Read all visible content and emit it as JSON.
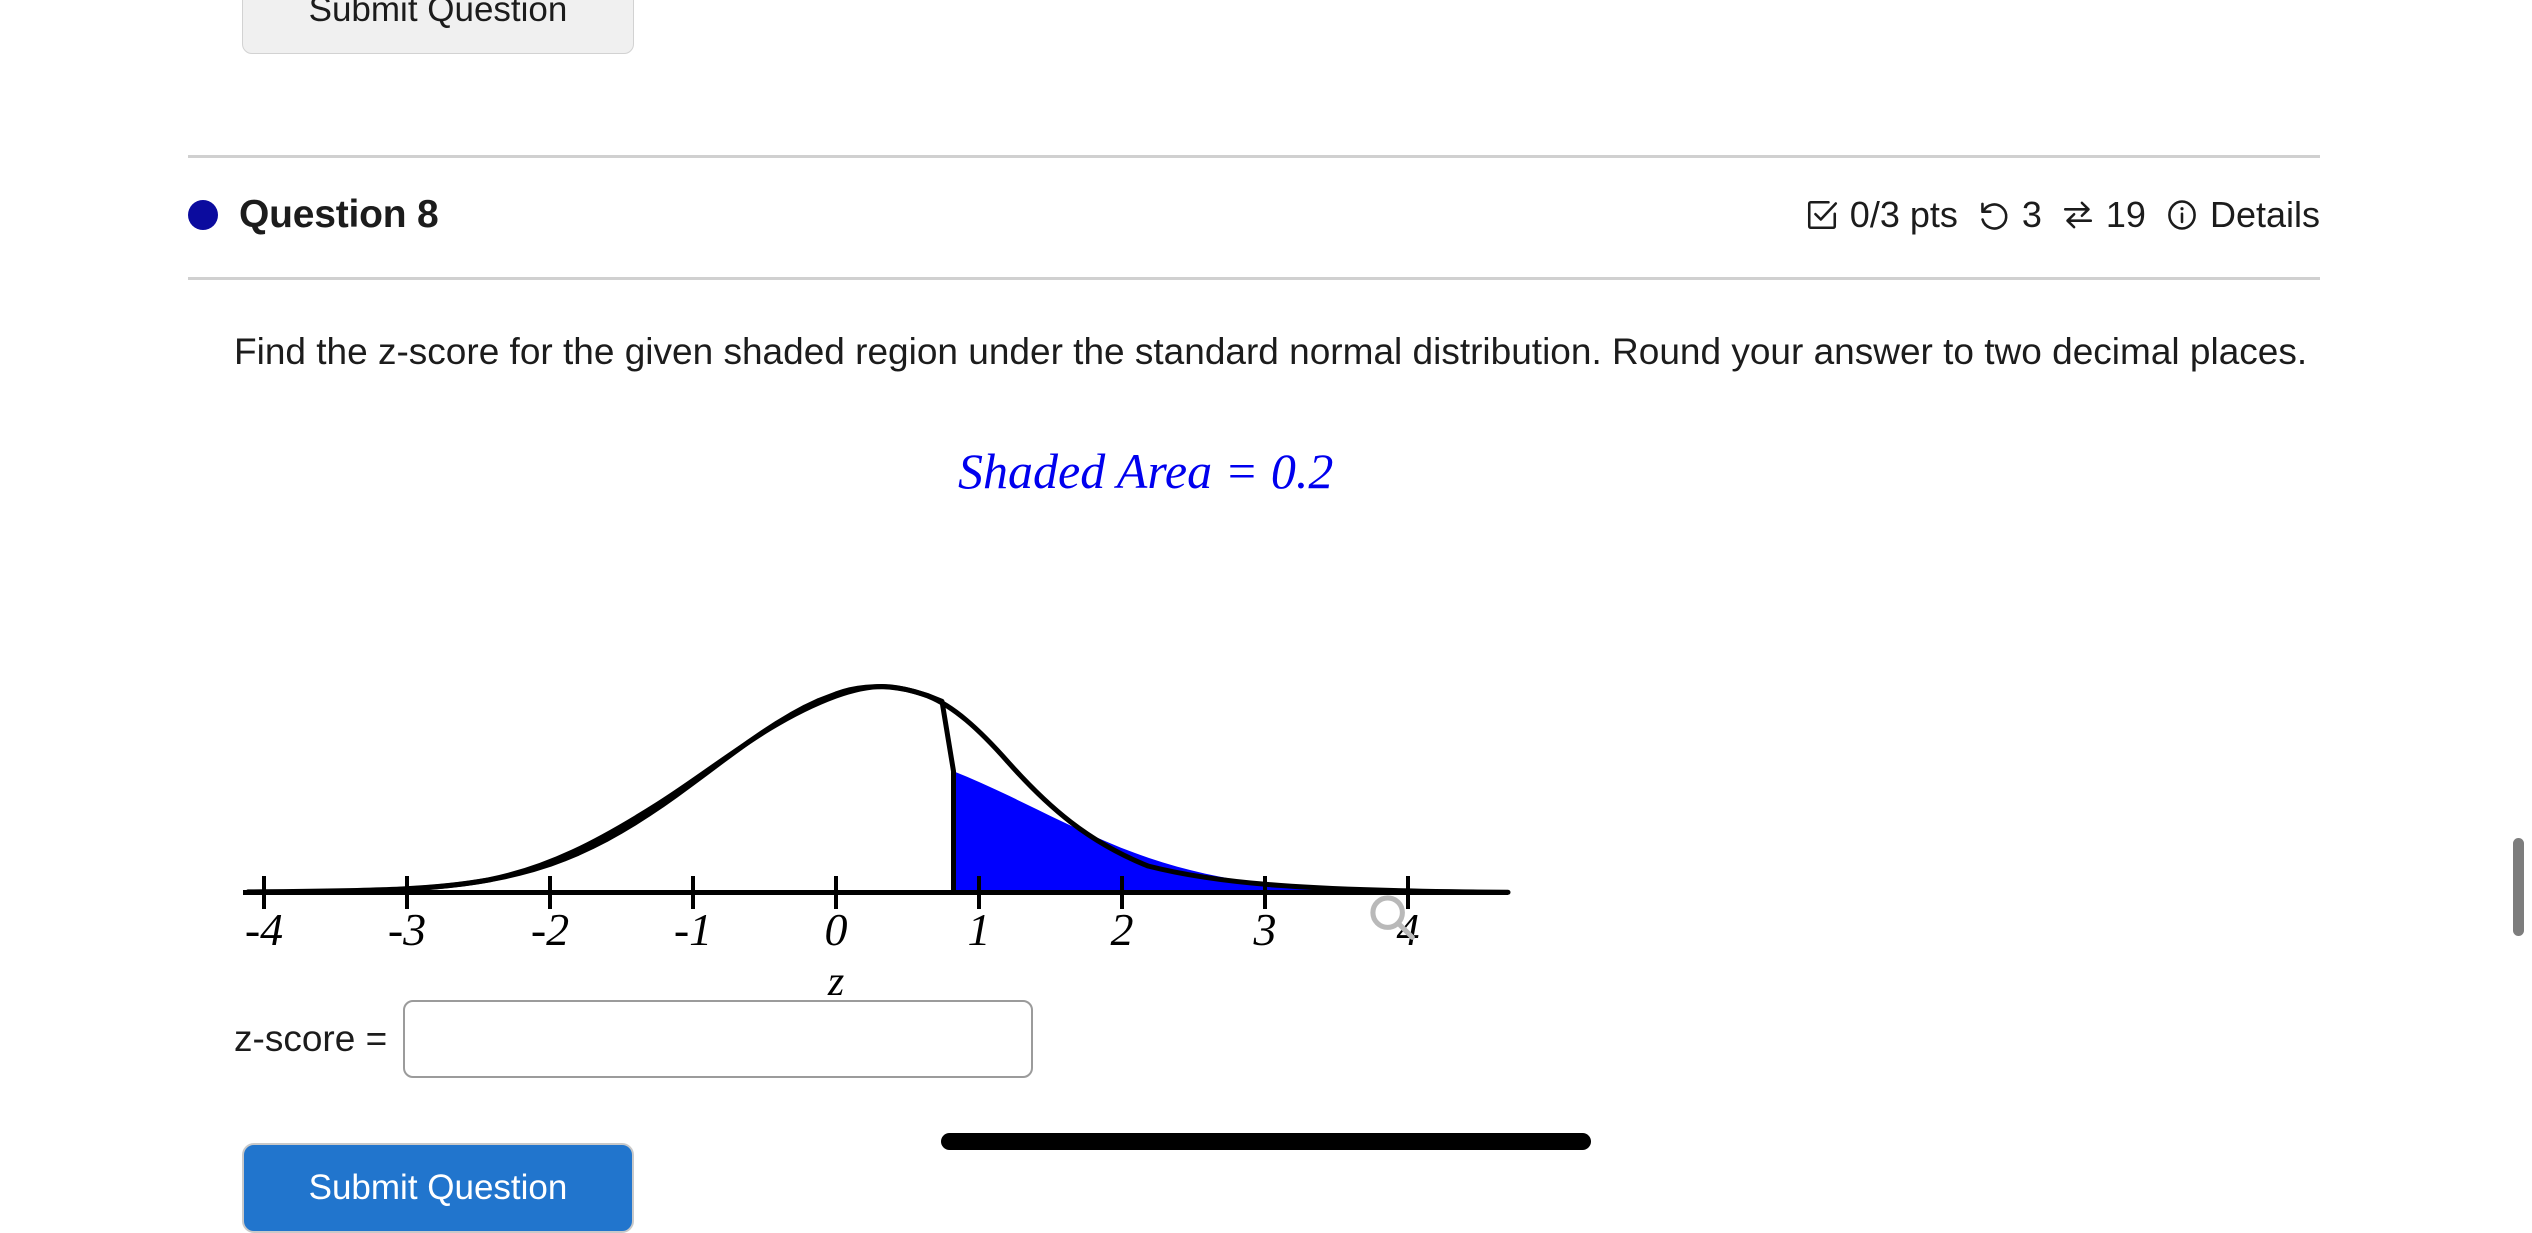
{
  "top_button": {
    "label": "Submit Question"
  },
  "question": {
    "title": "Question 8",
    "dot_color": "#0b0b9e",
    "meta": {
      "points": "0/3 pts",
      "points_icon": "checked-box-icon",
      "attempts": "3",
      "attempts_icon": "undo-arrow-icon",
      "shuffles": "19",
      "shuffles_icon": "swap-arrows-icon",
      "details": "Details",
      "details_icon": "info-circle-icon"
    },
    "prompt": "Find the z-score for the given shaded region under the standard normal distribution. Round your answer to two decimal places."
  },
  "answer": {
    "label": "z-score =",
    "value": "",
    "placeholder": ""
  },
  "bottom_button": {
    "label": "Submit Question"
  },
  "figure": {
    "magnifier_icon": "magnifier-icon",
    "shade_color": "#0000ff",
    "annotation_color": "#0000ee",
    "curve_color": "#000000"
  },
  "chart_data": {
    "type": "area",
    "title": "",
    "subtitle": "",
    "xlabel": "z",
    "ylabel": "",
    "annotation": "Shaded Area = 0.2",
    "annotation_color": "#0000ee",
    "xlim": [
      -4.3,
      4.3
    ],
    "ylim": [
      0,
      0.44
    ],
    "xticks": [
      -4,
      -3,
      -2,
      -1,
      0,
      1,
      2,
      3,
      4
    ],
    "xtick_labels": [
      "-4",
      "-3",
      "-2",
      "-1",
      "0",
      "1",
      "2",
      "3",
      "4"
    ],
    "grid": false,
    "legend": false,
    "distribution": "standard normal (mean 0, sd 1)",
    "shaded_region": {
      "from": 0.84,
      "to": 4.3,
      "area": 0.2,
      "fill": "#0000ff",
      "tail": "right"
    },
    "series": [
      {
        "name": "standard normal pdf",
        "x": [
          -4,
          -3.5,
          -3,
          -2.5,
          -2,
          -1.5,
          -1,
          -0.5,
          0,
          0.5,
          1,
          1.5,
          2,
          2.5,
          3,
          3.5,
          4
        ],
        "values": [
          0.0001,
          0.0009,
          0.0044,
          0.0175,
          0.054,
          0.1295,
          0.242,
          0.3521,
          0.3989,
          0.3521,
          0.242,
          0.1295,
          0.054,
          0.0175,
          0.0044,
          0.0009,
          0.0001
        ]
      }
    ]
  }
}
